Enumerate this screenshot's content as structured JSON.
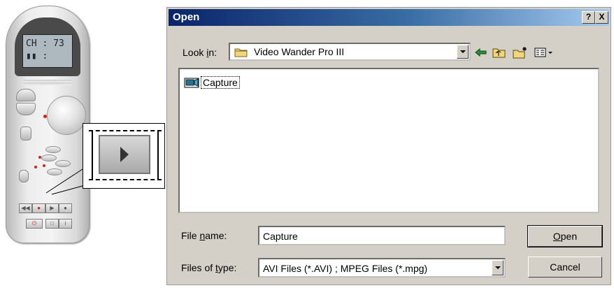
{
  "remote": {
    "lcd_line1": "CH : 73",
    "lcd_line2": "▮▮ :"
  },
  "dialog": {
    "title": "Open",
    "help_btn": "?",
    "close_btn": "X",
    "look_in_label": "Look in:",
    "look_in_value": "Video Wander Pro III",
    "files": [
      {
        "name": "Capture"
      }
    ],
    "file_name_label": "File name:",
    "file_name_value": "Capture",
    "files_of_type_label": "Files of type:",
    "files_of_type_value": "AVI Files (*.AVI) ; MPEG Files (*.mpg)",
    "open_button": "Open",
    "cancel_button": "Cancel"
  },
  "icons": [
    "folder-icon",
    "back-arrow-icon",
    "up-folder-icon",
    "new-folder-icon",
    "view-menu-icon",
    "video-file-icon",
    "play-icon"
  ],
  "colors": {
    "title_gradient_start": "#0a246a",
    "title_gradient_end": "#a6caf0",
    "dialog_face": "#d4d0c8"
  }
}
